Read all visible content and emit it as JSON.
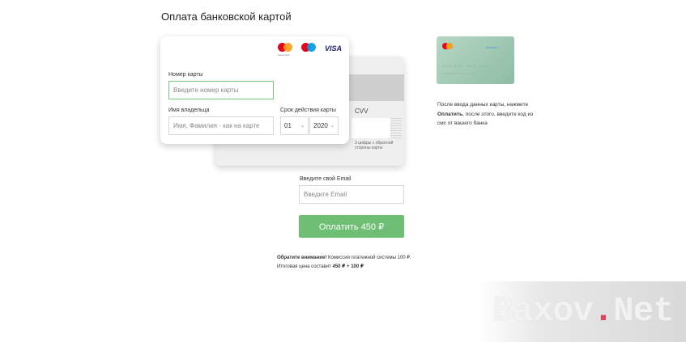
{
  "page": {
    "title": "Оплата банковской картой"
  },
  "card_front": {
    "brands": [
      "mastercard",
      "maestro",
      "VISA"
    ],
    "brand_caption": "mastercard",
    "card_number": {
      "label": "Номер карты",
      "placeholder": "Введите номер карты"
    },
    "holder": {
      "label": "Имя владельца",
      "placeholder": "Имя, Фамилия - как на карте"
    },
    "expiry": {
      "label": "Срок действия карты",
      "month": "01",
      "year": "2020"
    }
  },
  "card_back": {
    "cvv_label": "CVV",
    "cvv_hint": "3 цифры с обратной стороны карты"
  },
  "email": {
    "label": "Введите свой Email",
    "placeholder": "Введите Email"
  },
  "pay_button": {
    "label": "Оплатить 450 ₽"
  },
  "notice": {
    "bold": "Обратите внимание!",
    "text": " Комиссия платежной системы 100 ₽. Итоговая цена составит ",
    "total": "450 ₽ + 100 ₽"
  },
  "side_card": {
    "brand_text": "Maestro",
    "digits": "5845 6487 1875 1475"
  },
  "info": {
    "before": "После ввода данных карты, нажмите ",
    "bold": "Оплатить",
    "after": ", после этого, введите код из смс от вашего банка"
  },
  "watermark": {
    "text_a": "Baxov",
    "dot": ".",
    "text_b": "Net"
  },
  "colors": {
    "accent": "#6fbe75",
    "active_border": "#7cc47f",
    "visa": "#1a1f71"
  }
}
